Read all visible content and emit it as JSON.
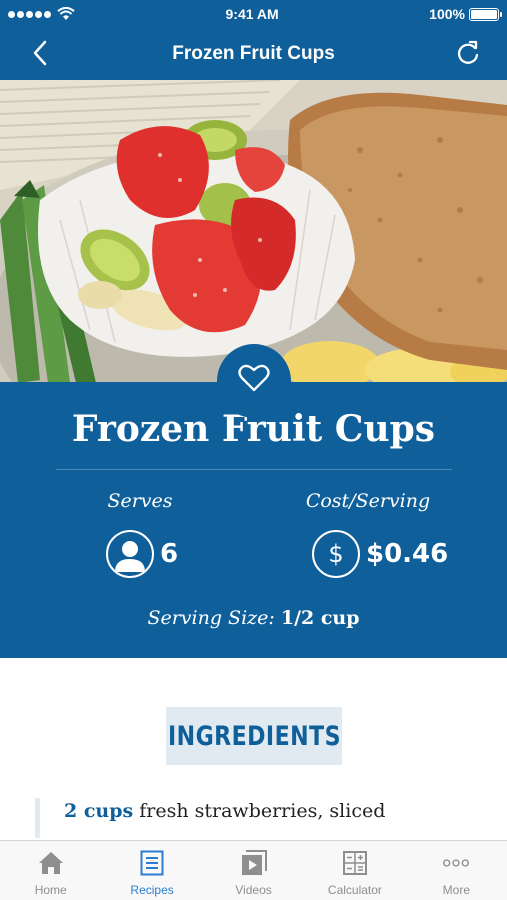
{
  "status_bar": {
    "time": "9:41 AM",
    "battery": "100%",
    "battery_level": 1.0
  },
  "nav": {
    "title": "Frozen Fruit Cups",
    "back_icon": "chevron-left-icon",
    "refresh_icon": "refresh-icon"
  },
  "recipe": {
    "title": "Frozen Fruit Cups",
    "serves_label": "Serves",
    "serves_value": "6",
    "cost_label": "Cost/Serving",
    "cost_value": "$0.46",
    "serving_size_label": "Serving Size:",
    "serving_size_value": "1/2 cup"
  },
  "ingredients": {
    "header": "INGREDIENTS",
    "items": [
      {
        "quantity": "2 cups",
        "name": "fresh strawberries, sliced"
      }
    ]
  },
  "tab_bar": {
    "tabs": [
      {
        "label": "Home",
        "icon": "home-icon",
        "active": false
      },
      {
        "label": "Recipes",
        "icon": "recipes-icon",
        "active": true
      },
      {
        "label": "Videos",
        "icon": "videos-icon",
        "active": false
      },
      {
        "label": "Calculator",
        "icon": "calculator-icon",
        "active": false
      },
      {
        "label": "More",
        "icon": "more-icon",
        "active": false
      }
    ]
  },
  "colors": {
    "brand_blue": "#0f5f9b",
    "active_tab": "#2b7dd0",
    "inactive_tab": "#8e8e8e",
    "ingredient_header_bg": "#e1e9f1"
  }
}
